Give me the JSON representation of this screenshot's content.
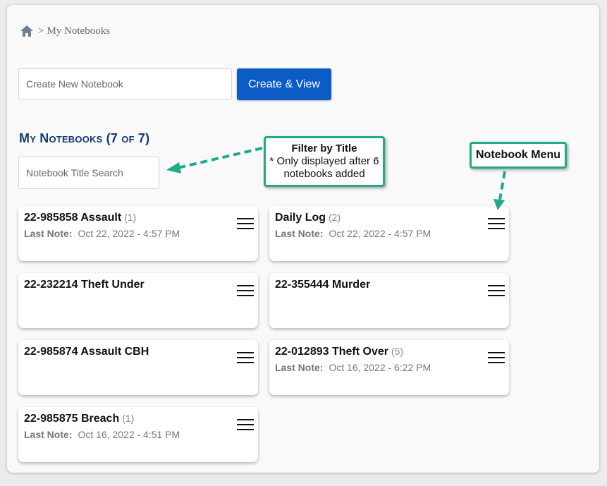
{
  "breadcrumb": {
    "separator": ">",
    "current": "My Notebooks"
  },
  "create": {
    "placeholder": "Create New Notebook",
    "button_label": "Create & View"
  },
  "section": {
    "title": "My Notebooks (7 of 7)"
  },
  "search": {
    "placeholder": "Notebook Title Search"
  },
  "notebooks": [
    {
      "title": "22-985858 Assault",
      "count": "(1)",
      "last_note_label": "Last Note:",
      "last_note": "Oct 22, 2022 - 4:57 PM"
    },
    {
      "title": "Daily Log",
      "count": "(2)",
      "last_note_label": "Last Note:",
      "last_note": "Oct 22, 2022 - 4:57 PM"
    },
    {
      "title": "22-232214 Theft Under"
    },
    {
      "title": "22-355444 Murder"
    },
    {
      "title": "22-985874 Assault CBH"
    },
    {
      "title": "22-012893 Theft Over",
      "count": "(5)",
      "last_note_label": "Last Note:",
      "last_note": "Oct 16, 2022 - 6:22 PM"
    },
    {
      "title": "22-985875 Breach",
      "count": "(1)",
      "last_note_label": "Last Note:",
      "last_note": "Oct 16, 2022 - 4:51 PM"
    }
  ],
  "callouts": {
    "filter_title": "Filter by Title",
    "filter_line1": "* Only displayed after 6",
    "filter_line2": "notebooks added",
    "menu_title": "Notebook Menu"
  },
  "icons": {
    "home": "home-icon",
    "menu": "hamburger-menu-icon"
  },
  "colors": {
    "accent": "#0d5bc6",
    "section_title": "#13396e",
    "callout_border": "#22a88a"
  }
}
